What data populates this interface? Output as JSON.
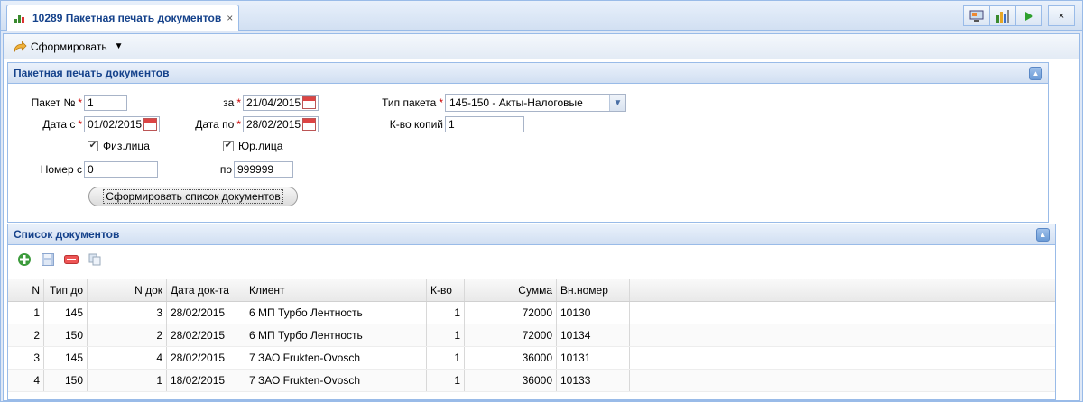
{
  "tab": {
    "title": "10289 Пакетная печать документов",
    "close": "×"
  },
  "window_buttons": {
    "close": "×"
  },
  "toolbar": {
    "form_label": "Сформировать"
  },
  "panel_form": {
    "title": "Пакетная печать документов",
    "packet_no_label": "Пакет №",
    "packet_no_value": "1",
    "za_label": "за",
    "za_value": "21/04/2015",
    "tip_label": "Тип пакета",
    "tip_value": "145-150 - Акты-Налоговые",
    "date_from_label": "Дата с",
    "date_from_value": "01/02/2015",
    "date_to_label": "Дата по",
    "date_to_value": "28/02/2015",
    "copies_label": "К-во копий",
    "copies_value": "1",
    "fiz_label": "Физ.лица",
    "fiz_checked": true,
    "yur_label": "Юр.лица",
    "yur_checked": true,
    "num_from_label": "Номер с",
    "num_from_value": "0",
    "num_to_label": "по",
    "num_to_value": "999999",
    "build_button": "Сформировать список документов"
  },
  "panel_list": {
    "title": "Список документов",
    "columns": [
      "N",
      "Тип до",
      "N док",
      "Дата док-та",
      "Клиент",
      "К-во",
      "Сумма",
      "Вн.номер"
    ],
    "rows": [
      [
        "1",
        "145",
        "3",
        "28/02/2015",
        "6 МП Турбо Лентность",
        "1",
        "72000",
        "10130"
      ],
      [
        "2",
        "150",
        "2",
        "28/02/2015",
        "6 МП Турбо Лентность",
        "1",
        "72000",
        "10134"
      ],
      [
        "3",
        "145",
        "4",
        "28/02/2015",
        "7 ЗАО Frukten-Ovosch",
        "1",
        "36000",
        "10131"
      ],
      [
        "4",
        "150",
        "1",
        "18/02/2015",
        "7 ЗАО Frukten-Ovosch",
        "1",
        "36000",
        "10133"
      ]
    ]
  }
}
